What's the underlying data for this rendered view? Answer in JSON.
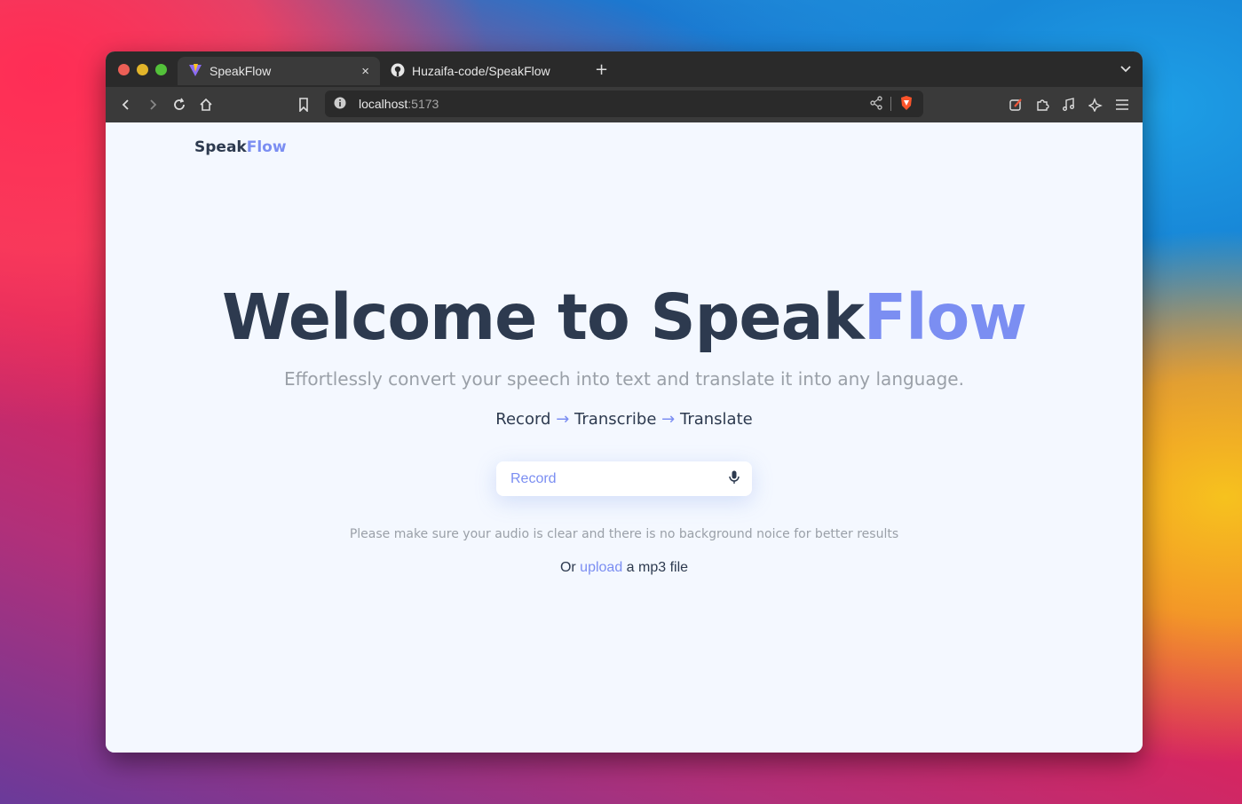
{
  "browser": {
    "tabs": [
      {
        "label": "SpeakFlow",
        "active": true,
        "close": "×"
      },
      {
        "label": "Huzaifa-code/SpeakFlow",
        "active": false
      }
    ],
    "new_tab": "+",
    "tab_menu": "⌄",
    "url_host": "localhost",
    "url_port": ":5173"
  },
  "app": {
    "brand_main": "Speak",
    "brand_accent": "Flow",
    "hero_main": "Welcome to Speak",
    "hero_accent": "Flow",
    "subtitle": "Effortlessly convert your speech into text and translate it into any language.",
    "steps": {
      "step1": "Record",
      "step2": "Transcribe",
      "step3": "Translate",
      "arrow": "→"
    },
    "record_label": "Record",
    "note": "Please make sure your audio is clear and there is no background noice for better results",
    "upload_prefix": "Or",
    "upload_link": "upload",
    "upload_suffix": "a mp3 file"
  },
  "colors": {
    "accent": "#7b8ef2",
    "text": "#2d3a4f",
    "muted": "#9aa0a8",
    "page_bg": "#f4f8ff"
  }
}
